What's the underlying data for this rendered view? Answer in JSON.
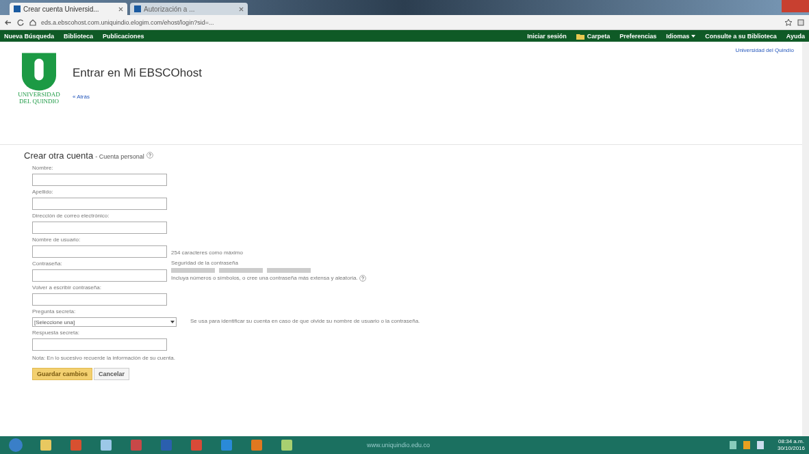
{
  "browser": {
    "tabs": [
      {
        "title": "Crear cuenta Universid...",
        "selected": true
      },
      {
        "title": "Autorización a ...",
        "selected": false
      }
    ],
    "url": "eds.a.ebscohost.com.uniquindio.elogim.com/ehost/login?sid=..."
  },
  "nav": {
    "left": [
      "Nueva Búsqueda",
      "Biblioteca",
      "Publicaciones"
    ],
    "right": [
      {
        "label": "Iniciar sesión",
        "kind": "link"
      },
      {
        "label": "Carpeta",
        "kind": "folder"
      },
      {
        "label": "Preferencias",
        "kind": "link"
      },
      {
        "label": "Idiomas",
        "kind": "menu"
      },
      {
        "label": "Consulte a su Biblioteca",
        "kind": "link"
      },
      {
        "label": "Ayuda",
        "kind": "link"
      }
    ]
  },
  "header": {
    "logo_text": [
      "UNIVERSIDAD",
      "DEL QUINDIO"
    ],
    "title": "Entrar en Mi EBSCOhost",
    "back": "« Atrás",
    "institution": "Universidad del Quindío"
  },
  "form": {
    "title": "Crear otra cuenta",
    "subtitle": "- Cuenta personal",
    "fields": [
      {
        "label": "Nombre:",
        "kind": "text"
      },
      {
        "label": "Apellido:",
        "kind": "text"
      },
      {
        "label": "Dirección de correo electrónico:",
        "kind": "text"
      },
      {
        "label": "Nombre de usuario:",
        "kind": "text",
        "note": "254 caracteres como máximo"
      },
      {
        "label": "Contraseña:",
        "kind": "password",
        "strength_label": "Seguridad de la contraseña",
        "level": 0,
        "hint": "Incluya números o símbolos, o cree una contraseña más extensa y aleatoria."
      },
      {
        "label": "Volver a escribir contraseña:",
        "kind": "text"
      },
      {
        "label": "Pregunta secreta:",
        "kind": "select",
        "value": "[Seleccione una]",
        "note": "Se usa para identificar su cuenta en caso de que olvide su nombre de usuario o la contraseña."
      },
      {
        "label": "Respuesta secreta:",
        "kind": "text"
      }
    ],
    "footnote": "Nota: En lo sucesivo recuerde la información de su cuenta.",
    "buttons": [
      {
        "label": "Guardar cambios",
        "kind": "primary"
      },
      {
        "label": "Cancelar",
        "kind": "secondary"
      }
    ]
  },
  "taskbar": {
    "center_text": "www.uniquindio.edu.co",
    "time": "08:34 a.m.",
    "date": "30/10/2016"
  }
}
